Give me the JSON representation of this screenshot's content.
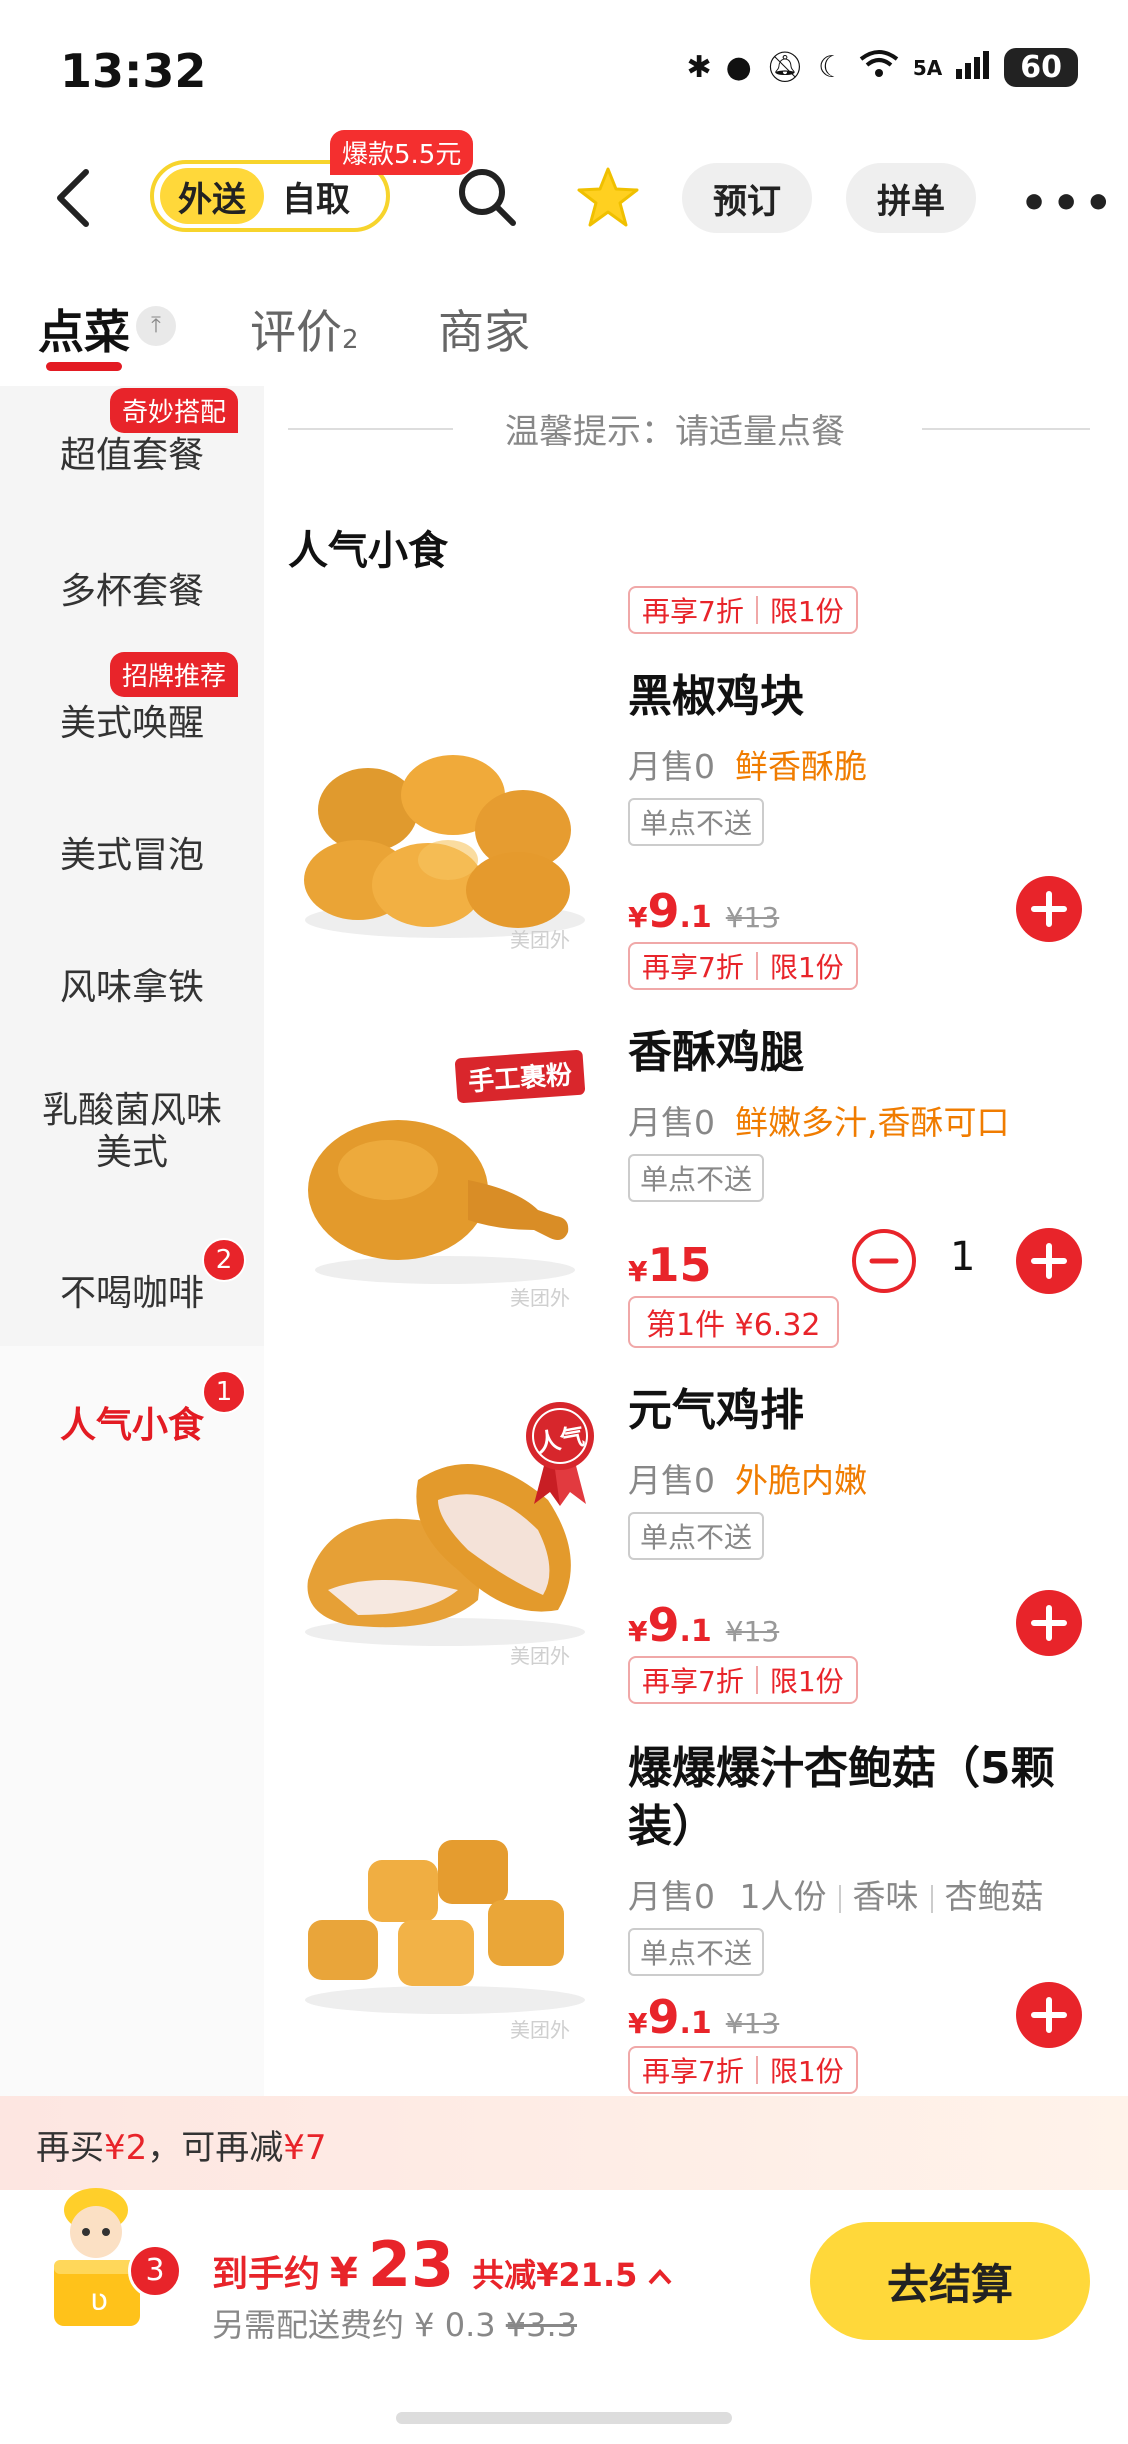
{
  "status_bar": {
    "time": "13:32",
    "battery": "60",
    "network": "5A"
  },
  "header": {
    "mode_active": "外送",
    "mode_inactive": "自取",
    "hot_tag": "爆款5.5元",
    "preorder": "预订",
    "group_order": "拼单",
    "more": "•••"
  },
  "tabs": [
    {
      "label": "点菜",
      "sub": ""
    },
    {
      "label": "评价",
      "sub": "2"
    },
    {
      "label": "商家",
      "sub": ""
    }
  ],
  "sidebar": {
    "items": [
      {
        "label": "超值套餐",
        "tag": "奇妙搭配"
      },
      {
        "label": "多杯套餐"
      },
      {
        "label": "美式唤醒",
        "tag": "招牌推荐"
      },
      {
        "label": "美式冒泡"
      },
      {
        "label": "风味拿铁"
      },
      {
        "label": "乳酸菌风味美式"
      },
      {
        "label": "不喝咖啡",
        "badge": "2"
      },
      {
        "label": "人气小食",
        "badge": "1"
      }
    ]
  },
  "tip": "温馨提示：请适量点餐",
  "section_title": "人气小食",
  "top_tags": {
    "discount": "再享7折",
    "limit": "限1份"
  },
  "products": [
    {
      "name": "黑椒鸡块",
      "sales": "月售0",
      "desc": "鲜香酥脆",
      "note": "单点不送",
      "price_yen": "¥",
      "price_int": "9",
      "price_dec": ".1",
      "orig_price": "¥13",
      "discount": "再享7折",
      "limit": "限1份"
    },
    {
      "name": "香酥鸡腿",
      "sales": "月售0",
      "desc": "鲜嫩多汁,香酥可口",
      "note": "单点不送",
      "price_yen": "¥",
      "price_int": "15",
      "qty": "1",
      "first_tag": "第1件 ¥6.32",
      "img_badge": "手工裹粉"
    },
    {
      "name": "元气鸡排",
      "sales": "月售0",
      "desc": "外脆内嫩",
      "note": "单点不送",
      "price_yen": "¥",
      "price_int": "9",
      "price_dec": ".1",
      "orig_price": "¥13",
      "discount": "再享7折",
      "limit": "限1份",
      "img_badge": "人气"
    },
    {
      "name": "爆爆爆汁杏鲍菇（5颗装）",
      "sales": "月售0",
      "spec1": "1人份",
      "spec2": "香味",
      "spec3": "杏鲍菇",
      "note": "单点不送",
      "price_yen": "¥",
      "price_int": "9",
      "price_dec": ".1",
      "orig_price": "¥13",
      "discount": "再享7折",
      "limit": "限1份"
    }
  ],
  "watermark": "美团外",
  "promo": {
    "pre": "再买",
    "amount1": "¥2",
    "mid": "，可再减",
    "amount2": "¥7"
  },
  "cart": {
    "count": "3",
    "label": "到手约",
    "yen": "¥",
    "total": "23",
    "saved": "共减¥21.5",
    "fee_label": "另需配送费约 ¥ 0.3",
    "fee_orig": "¥3.3",
    "checkout": "去结算"
  },
  "colors": {
    "brand_yellow": "#ffd83a",
    "accent_red": "#e8242a",
    "desc_orange": "#f07c00"
  }
}
